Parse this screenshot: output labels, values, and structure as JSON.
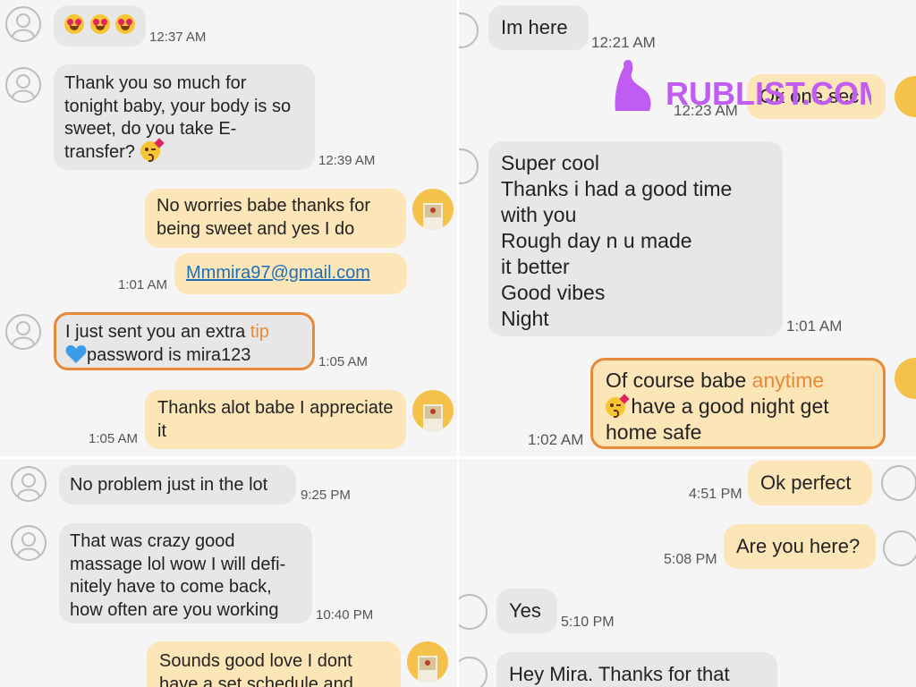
{
  "panels": {
    "top_left": {
      "messages": [
        {
          "emoji": "heart-eyes-emoji x3",
          "time": "12:37 AM"
        },
        {
          "text": "Thank you so much for tonight baby, your body is so sweet, do you take E-transfer?",
          "time": "12:39 AM"
        },
        {
          "text": "No worries babe thanks for being sweet and yes I do"
        },
        {
          "link": "Mmmira97@gmail.com",
          "time": "1:01 AM"
        },
        {
          "text_a": "I just sent you an extra",
          "text_b": "tip",
          "text_c": "password is mira123",
          "time": "1:05 AM"
        },
        {
          "text": "Thanks alot babe I appreciate it",
          "time": "1:05 AM"
        }
      ]
    },
    "top_right": {
      "messages": [
        {
          "text": "Im here",
          "time": "12:21 AM"
        },
        {
          "text": "Ok one sec",
          "time": "12:23 AM"
        },
        {
          "lines": [
            "Super cool",
            "Thanks i had a good time",
            "with you",
            "Rough day n u made",
            "it better",
            "Good vibes",
            "Night"
          ],
          "time": "1:01 AM"
        },
        {
          "text_a": "Of course babe",
          "text_b": "anytime",
          "text_c": "have a good night get home safe",
          "time": "1:02 AM"
        }
      ]
    },
    "bottom_left": {
      "messages": [
        {
          "text": "No problem just in the lot",
          "time": "9:25 PM"
        },
        {
          "text": "That was crazy good massage lol wow I will defi-nitely have to come back, how often are you working",
          "time": "10:40 PM"
        },
        {
          "text": "Sounds good love I dont have a set schedule and"
        }
      ]
    },
    "bottom_right": {
      "messages": [
        {
          "text": "Ok perfect",
          "time": "4:51 PM"
        },
        {
          "text": "Are you here?",
          "time": "5:08 PM"
        },
        {
          "text": "Yes",
          "time": "5:10 PM"
        },
        {
          "text": "Hey Mira. Thanks for that"
        }
      ]
    }
  },
  "watermark": {
    "text": "RUBLIST.COM"
  },
  "colors": {
    "incoming_bubble": "#e7e7e7",
    "outgoing_bubble": "#fce6b8",
    "highlight": "#e8893a",
    "link": "#1e6fb8"
  }
}
